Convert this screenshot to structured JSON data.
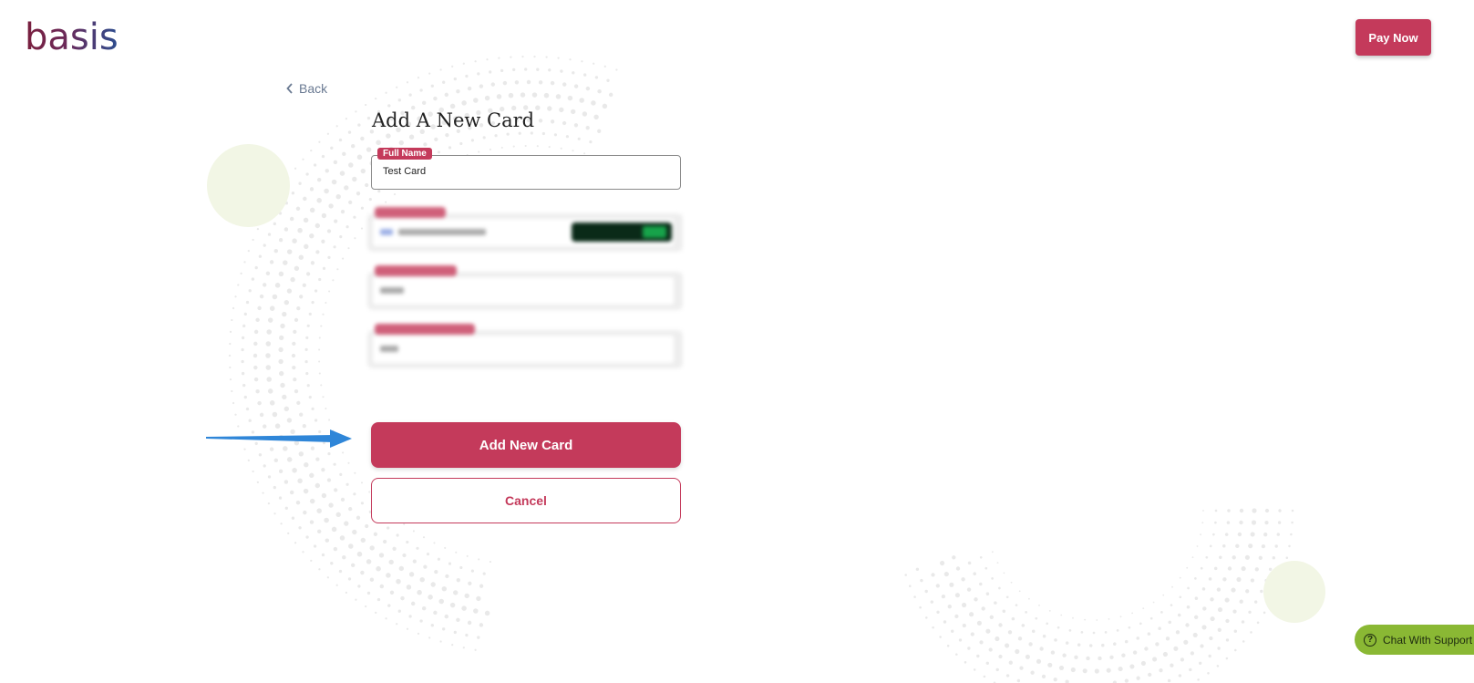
{
  "app": {
    "logo_text": "basis"
  },
  "header": {
    "pay_now_label": "Pay Now"
  },
  "nav": {
    "back_label": "Back"
  },
  "form": {
    "title": "Add A New Card",
    "full_name": {
      "label": "Full Name",
      "value": "Test Card"
    },
    "add_button_label": "Add New Card",
    "cancel_button_label": "Cancel"
  },
  "support": {
    "chat_label": "Chat With Support"
  },
  "colors": {
    "accent": "#c43a5b",
    "chat": "#8ab834",
    "decor_circle": "#f2f6e5"
  }
}
